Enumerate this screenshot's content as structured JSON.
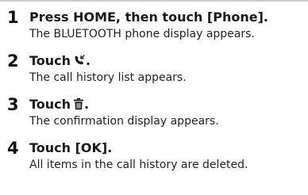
{
  "steps": [
    {
      "number": "1",
      "action": "Press HOME, then touch [Phone].",
      "result": "The BLUETOOTH phone display appears."
    },
    {
      "number": "2",
      "action_prefix": "Touch",
      "action_icon": "call-history-icon",
      "action_suffix": ".",
      "result": "The call history list appears."
    },
    {
      "number": "3",
      "action_prefix": "Touch",
      "action_icon": "trash-icon",
      "action_suffix": ".",
      "result": "The confirmation display appears."
    },
    {
      "number": "4",
      "action": "Touch [OK].",
      "result": "All items in the call history are deleted."
    }
  ],
  "colors": {
    "text": "#1a1a1a",
    "rule": "#cccccc"
  }
}
